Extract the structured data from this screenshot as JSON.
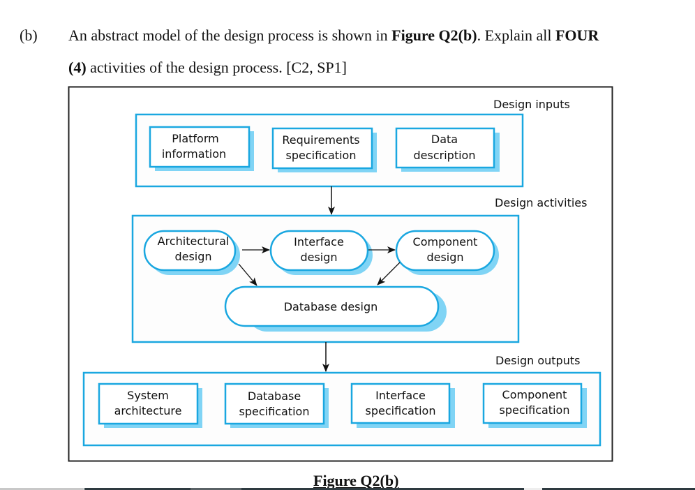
{
  "question": {
    "label": "(b)",
    "line1": {
      "part1": "An abstract model of the design process is shown in ",
      "bold1": "Figure Q2(b)",
      "part2": ". Explain all ",
      "bold2": "FOUR"
    },
    "line2": {
      "bold1": "(4)",
      "part1": " activities of the design process. [C2, SP1]"
    }
  },
  "diagram": {
    "colors": {
      "frame": "#222222",
      "group_border": "#1aa7e0",
      "node_border": "#1aa7e0",
      "shadow": "#80d4f5",
      "arrow": "#111111",
      "text": "#111111"
    },
    "groups": {
      "inputs": {
        "title": "Design inputs",
        "items": [
          {
            "line1": "Platform",
            "line2": "information"
          },
          {
            "line1": "Requirements",
            "line2": "specification"
          },
          {
            "line1": "Data",
            "line2": "description"
          }
        ]
      },
      "activities": {
        "title": "Design activities",
        "items": [
          {
            "line1": "Architectural",
            "line2": "design"
          },
          {
            "line1": "Interface",
            "line2": "design"
          },
          {
            "line1": "Component",
            "line2": "design"
          },
          {
            "line1": "Database design",
            "line2": ""
          }
        ]
      },
      "outputs": {
        "title": "Design outputs",
        "items": [
          {
            "line1": "System",
            "line2": "architecture"
          },
          {
            "line1": "Database",
            "line2": "specification"
          },
          {
            "line1": "Interface",
            "line2": "specification"
          },
          {
            "line1": "Component",
            "line2": "specification"
          }
        ]
      }
    },
    "edges": [
      {
        "from": "Design inputs",
        "to": "Design activities"
      },
      {
        "from": "Architectural design",
        "to": "Interface design"
      },
      {
        "from": "Interface design",
        "to": "Component design"
      },
      {
        "from": "Architectural design",
        "to": "Database design"
      },
      {
        "from": "Component design",
        "to": "Database design"
      },
      {
        "from": "Design activities",
        "to": "Design outputs"
      }
    ]
  },
  "caption": "Figure Q2(b)"
}
